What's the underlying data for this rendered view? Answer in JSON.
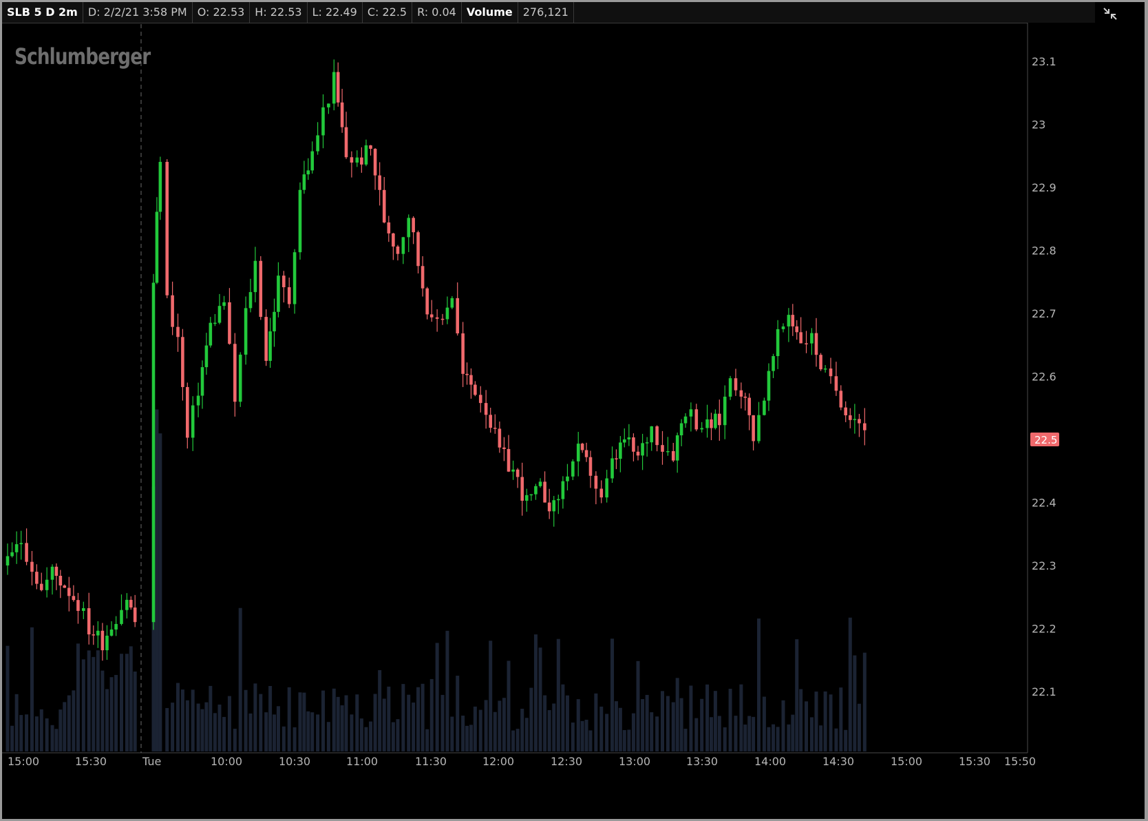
{
  "header": {
    "symbol": "SLB 5 D 2m",
    "date": "D: 2/2/21 3:58 PM",
    "open": "O: 22.53",
    "high": "H: 22.53",
    "low": "L: 22.49",
    "close": "C: 22.5",
    "range": "R: 0.04",
    "volume_label": "Volume",
    "volume_value": "276,121",
    "expand_icon": "expand-collapse-icon"
  },
  "watermark": "Schlumberger",
  "colors": {
    "up": "#22c93b",
    "down": "#f0696c",
    "volume": "#1b2333",
    "axis_text": "#b5b5b5",
    "session_line": "#6b6b6b",
    "last_price_bg": "#f0696c"
  },
  "chart_data": {
    "type": "candlestick",
    "title": "",
    "xlabel": "",
    "ylabel": "",
    "ylim": [
      22.0,
      23.15
    ],
    "y_ticks": [
      "23.1",
      "23",
      "22.9",
      "22.8",
      "22.7",
      "22.6",
      "22.5",
      "22.4",
      "22.3",
      "22.2",
      "22.1"
    ],
    "x_ticks": [
      "15:00",
      "15:30",
      "Tue",
      "10:00",
      "10:30",
      "11:00",
      "11:30",
      "12:00",
      "12:30",
      "13:00",
      "13:30",
      "14:00",
      "14:30",
      "15:00",
      "15:30",
      "15:50"
    ],
    "session_break_label": "Tue",
    "last_price": "22.5",
    "price_path": [
      [
        15.0,
        22.3
      ],
      [
        15.1,
        22.34
      ],
      [
        15.18,
        22.3
      ],
      [
        15.25,
        22.26
      ],
      [
        15.33,
        22.29
      ],
      [
        15.42,
        22.27
      ],
      [
        15.52,
        22.24
      ],
      [
        15.6,
        22.2
      ],
      [
        15.7,
        22.18
      ],
      [
        15.8,
        22.22
      ],
      [
        15.88,
        22.25
      ],
      [
        15.97,
        22.19
      ],
      [
        9.5,
        22.75
      ],
      [
        9.55,
        22.95
      ],
      [
        9.6,
        22.72
      ],
      [
        9.68,
        22.66
      ],
      [
        9.75,
        22.5
      ],
      [
        9.83,
        22.58
      ],
      [
        9.92,
        22.68
      ],
      [
        10.02,
        22.72
      ],
      [
        10.1,
        22.56
      ],
      [
        10.18,
        22.7
      ],
      [
        10.25,
        22.78
      ],
      [
        10.33,
        22.63
      ],
      [
        10.42,
        22.75
      ],
      [
        10.5,
        22.72
      ],
      [
        10.58,
        22.9
      ],
      [
        10.67,
        22.95
      ],
      [
        10.75,
        23.02
      ],
      [
        10.83,
        23.07
      ],
      [
        10.92,
        22.95
      ],
      [
        11.0,
        22.94
      ],
      [
        11.1,
        22.96
      ],
      [
        11.2,
        22.85
      ],
      [
        11.3,
        22.8
      ],
      [
        11.38,
        22.86
      ],
      [
        11.45,
        22.78
      ],
      [
        11.55,
        22.68
      ],
      [
        11.63,
        22.7
      ],
      [
        11.7,
        22.73
      ],
      [
        11.78,
        22.6
      ],
      [
        11.87,
        22.58
      ],
      [
        11.95,
        22.55
      ],
      [
        12.05,
        22.48
      ],
      [
        12.15,
        22.45
      ],
      [
        12.25,
        22.4
      ],
      [
        12.35,
        22.42
      ],
      [
        12.45,
        22.39
      ],
      [
        12.55,
        22.45
      ],
      [
        12.63,
        22.48
      ],
      [
        12.72,
        22.45
      ],
      [
        12.8,
        22.4
      ],
      [
        12.88,
        22.46
      ],
      [
        12.97,
        22.5
      ],
      [
        13.07,
        22.47
      ],
      [
        13.17,
        22.52
      ],
      [
        13.25,
        22.49
      ],
      [
        13.33,
        22.48
      ],
      [
        13.42,
        22.55
      ],
      [
        13.5,
        22.53
      ],
      [
        13.58,
        22.52
      ],
      [
        13.67,
        22.53
      ],
      [
        13.75,
        22.6
      ],
      [
        13.83,
        22.58
      ],
      [
        13.92,
        22.51
      ],
      [
        14.0,
        22.57
      ],
      [
        14.1,
        22.66
      ],
      [
        14.18,
        22.7
      ],
      [
        14.27,
        22.66
      ],
      [
        14.35,
        22.66
      ],
      [
        14.45,
        22.6
      ],
      [
        14.53,
        22.58
      ],
      [
        14.6,
        22.55
      ],
      [
        14.7,
        22.53
      ],
      [
        14.78,
        22.5
      ]
    ],
    "volume_note": "volume histogram bars along bottom of price pane",
    "grid": false,
    "legend": "none"
  }
}
